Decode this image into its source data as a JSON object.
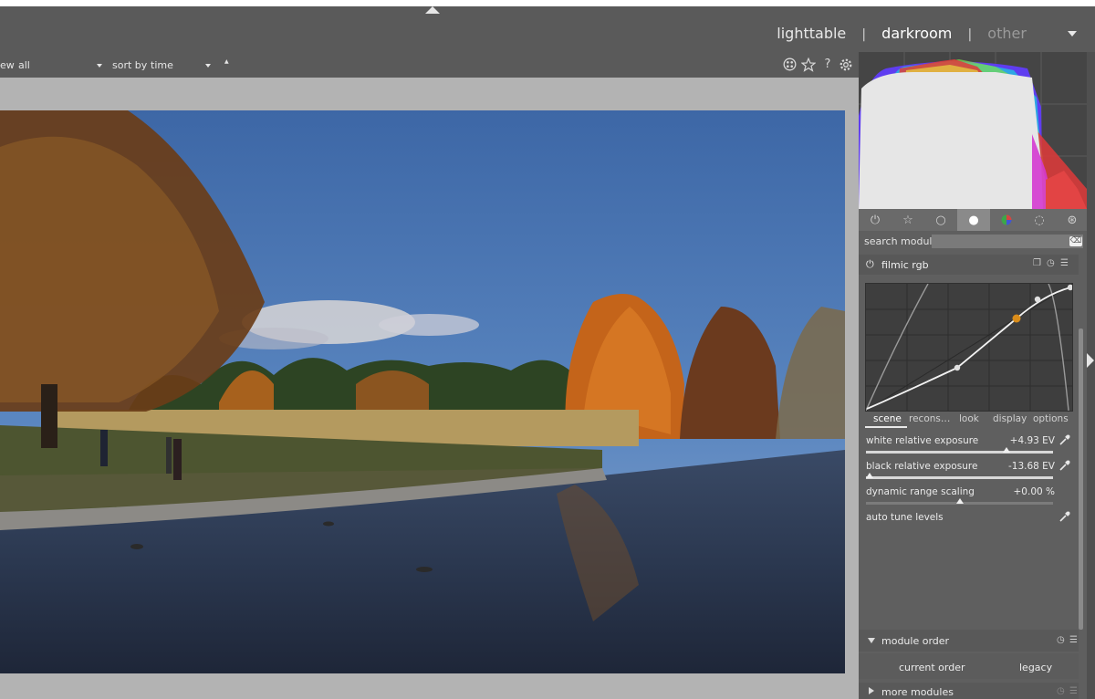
{
  "header": {
    "views": [
      {
        "label": "lighttable",
        "state": "normal"
      },
      {
        "label": "darkroom",
        "state": "active"
      },
      {
        "label": "other",
        "state": "dim"
      }
    ],
    "separator": "|"
  },
  "filterbar": {
    "view_label": "ew",
    "view_value": "all",
    "sort_label": "sort by",
    "sort_value": "time",
    "order_glyph": "▲",
    "icons": [
      "grouping-icon",
      "star-icon",
      "help-icon",
      "gear-icon"
    ]
  },
  "right_panel": {
    "group_tabs": [
      "power-icon",
      "star-icon",
      "circle-icon",
      "filled-circle-icon",
      "color-icon",
      "correct-icon",
      "effect-icon"
    ],
    "search": {
      "label": "search module",
      "placeholder": ""
    },
    "filmic": {
      "title": "filmic rgb",
      "tabs": [
        "scene",
        "recons…",
        "look",
        "display",
        "options"
      ],
      "active_tab": "scene",
      "sliders": [
        {
          "label": "white relative exposure",
          "value": "+4.93 EV",
          "fraction": 0.75
        },
        {
          "label": "black relative exposure",
          "value": "-13.68 EV",
          "fraction": 0.02
        },
        {
          "label": "dynamic range scaling",
          "value": "+0.00 %",
          "fraction": 0.5
        }
      ],
      "auto_tune": "auto tune levels"
    },
    "module_order": {
      "title": "module order",
      "current": "current order",
      "value": "legacy"
    },
    "more_modules": {
      "title": "more modules"
    }
  },
  "colors": {
    "accent": "#d98c1a",
    "panel": "#5f5f5f",
    "canvas": "#b3b3b3"
  }
}
